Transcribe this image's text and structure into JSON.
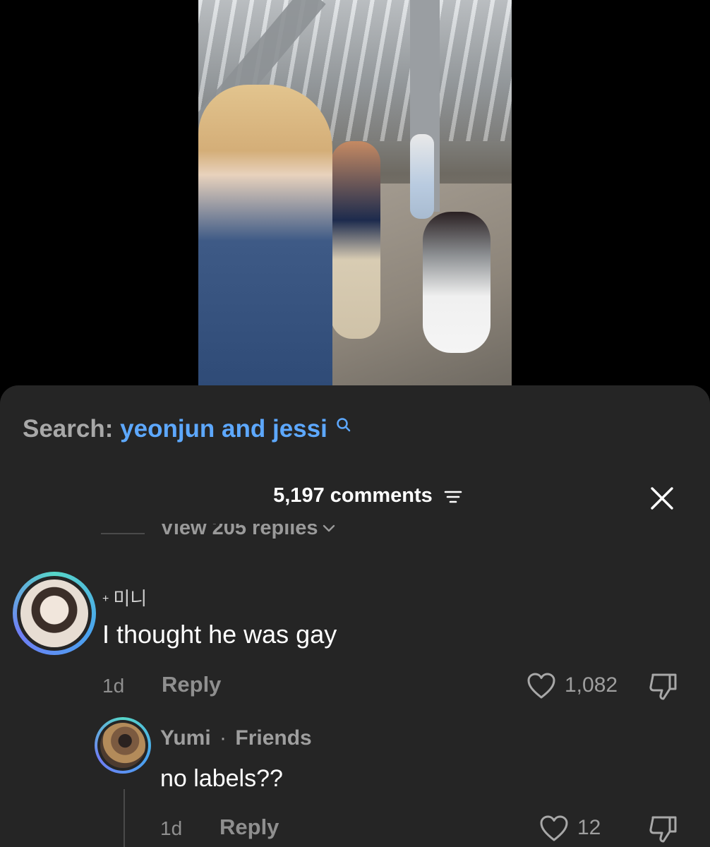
{
  "search": {
    "label": "Search:",
    "query": "yeonjun and jessi"
  },
  "comments": {
    "count_label": "5,197 comments",
    "view_replies": "View 205 replies"
  },
  "comment1": {
    "username": "미니",
    "sparkle": "+",
    "text": "I thought he was gay",
    "time": "1d",
    "reply_label": "Reply",
    "likes": "1,082"
  },
  "comment2": {
    "username": "Yumi",
    "relation": "Friends",
    "separator": "·",
    "text": "no labels??",
    "time": "1d",
    "reply_label": "Reply",
    "likes": "12"
  },
  "colors": {
    "sheet_background": "#252525",
    "search_query": "#5da8ff",
    "muted_text": "#8f8f8f"
  },
  "icons": [
    "search-icon",
    "sort-icon",
    "close-icon",
    "chevron-down-icon",
    "heart-icon",
    "dislike-icon"
  ]
}
